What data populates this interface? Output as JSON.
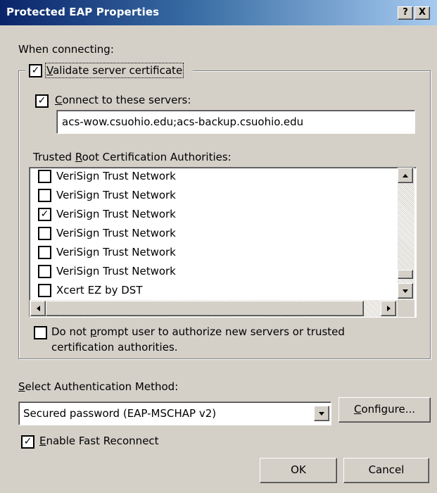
{
  "window": {
    "title": "Protected EAP Properties",
    "help_label": "?",
    "close_label": "X"
  },
  "when_connecting": "When connecting:",
  "validate_cert": {
    "label": "Validate server certificate",
    "checked": true
  },
  "connect_servers": {
    "label": "Connect to these servers:",
    "checked": true
  },
  "servers_value": "acs-wow.csuohio.edu;acs-backup.csuohio.edu",
  "trusted_root_label": "Trusted Root Certification Authorities:",
  "ca_list": [
    {
      "label": "VeriSign Trust Network",
      "checked": false
    },
    {
      "label": "VeriSign Trust Network",
      "checked": false
    },
    {
      "label": "VeriSign Trust Network",
      "checked": true
    },
    {
      "label": "VeriSign Trust Network",
      "checked": false
    },
    {
      "label": "VeriSign Trust Network",
      "checked": false
    },
    {
      "label": "VeriSign Trust Network",
      "checked": false
    },
    {
      "label": "Xcert EZ by DST",
      "checked": false
    }
  ],
  "no_prompt": {
    "line1": "Do not prompt user to authorize new servers or trusted",
    "line2": "certification authorities.",
    "checked": false
  },
  "auth_method_label": "Select Authentication Method:",
  "auth_method_value": "Secured password (EAP-MSCHAP v2)",
  "configure_label": "Configure...",
  "fast_reconnect": {
    "label": "Enable Fast Reconnect",
    "checked": true
  },
  "ok_label": "OK",
  "cancel_label": "Cancel",
  "check_mark": "✓"
}
